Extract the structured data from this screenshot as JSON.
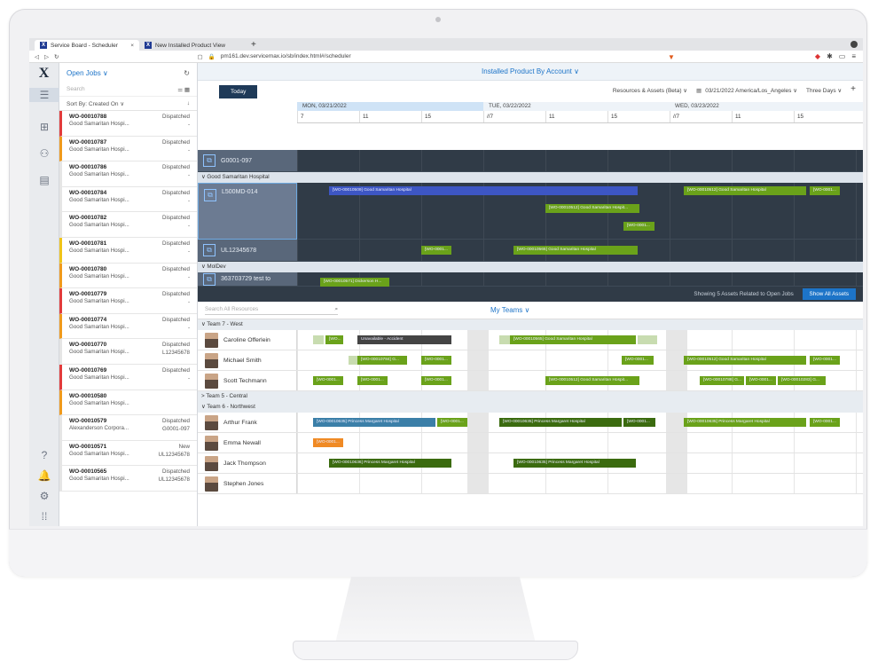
{
  "browser": {
    "tabs": [
      {
        "label": "Service Board - Scheduler",
        "close": "×"
      },
      {
        "label": "New Installed Product View",
        "close": ""
      }
    ],
    "new_tab": "+",
    "url": "pm161.dev.servicemax.io/sb/index.html#/scheduler"
  },
  "rail": {
    "logo": "X"
  },
  "jobs": {
    "title": "Open Jobs ∨",
    "search_placeholder": "Search",
    "sort_label": "Sort By: Created On ∨",
    "items": [
      {
        "wo": "WO-00010788",
        "account": "Good Samaritan Hospi...",
        "status": "Dispatched",
        "ip": "-",
        "color": "red"
      },
      {
        "wo": "WO-00010787",
        "account": "Good Samaritan Hospi...",
        "status": "Dispatched",
        "ip": "-",
        "color": "orange"
      },
      {
        "wo": "WO-00010786",
        "account": "Good Samaritan Hospi...",
        "status": "Dispatched",
        "ip": "-",
        "color": "white"
      },
      {
        "wo": "WO-00010784",
        "account": "Good Samaritan Hospi...",
        "status": "Dispatched",
        "ip": "-",
        "color": "white"
      },
      {
        "wo": "WO-00010782",
        "account": "Good Samaritan Hospi...",
        "status": "Dispatched",
        "ip": "-",
        "color": "white"
      },
      {
        "wo": "WO-00010781",
        "account": "Good Samaritan Hospi...",
        "status": "Dispatched",
        "ip": "-",
        "color": "yellow"
      },
      {
        "wo": "WO-00010780",
        "account": "Good Samaritan Hospi...",
        "status": "Dispatched",
        "ip": "-",
        "color": "orange"
      },
      {
        "wo": "WO-00010779",
        "account": "Good Samaritan Hospi...",
        "status": "Dispatched",
        "ip": "-",
        "color": "red"
      },
      {
        "wo": "WO-00010774",
        "account": "Good Samaritan Hospi...",
        "status": "Dispatched",
        "ip": "-",
        "color": "orange"
      },
      {
        "wo": "WO-00010770",
        "account": "Good Samaritan Hospi...",
        "status": "Dispatched",
        "ip": "L12345678",
        "color": "white"
      },
      {
        "wo": "WO-00010769",
        "account": "Good Samaritan Hospi...",
        "status": "Dispatched",
        "ip": "-",
        "color": "red"
      },
      {
        "wo": "WO-00010580",
        "account": "Good Samaritan Hospi...",
        "status": "",
        "ip": "",
        "color": "orange"
      },
      {
        "wo": "WO-00010579",
        "account": "Alexanderson Corpora...",
        "status": "Dispatched",
        "ip": "G0001-097",
        "color": "white"
      },
      {
        "wo": "WO-00010571",
        "account": "Good Samaritan Hospi...",
        "status": "New",
        "ip": "UL12345678",
        "color": "white"
      },
      {
        "wo": "WO-00010565",
        "account": "Good Samaritan Hospi...",
        "status": "Dispatched",
        "ip": "UL12345678",
        "color": "white"
      }
    ]
  },
  "header": {
    "title": "Installed Product By Account ∨"
  },
  "toolbar": {
    "today": "Today",
    "resources": "Resources & Assets (Beta) ∨",
    "date": "03/21/2022 America/Los_Angeles ∨",
    "range": "Three Days ∨",
    "add": "+"
  },
  "days": [
    "MON, 03/21/2022",
    "TUE, 03/22/2022",
    "WED, 03/23/2022"
  ],
  "hours": [
    "7",
    "11",
    "15",
    "//7",
    "11",
    "15",
    "//7",
    "11",
    "15"
  ],
  "assets": {
    "groups": [
      {
        "label": "",
        "rows": [
          {
            "name": "G0001-097",
            "bars": []
          }
        ]
      },
      {
        "label": "∨ Good Samaritan Hospital",
        "rows": [
          {
            "name": "L500MD-014",
            "bars": [
              "[WO-00010509] Good Samaritan Hospital",
              "[WO-00010512] Good Samaritan Hospital",
              "[WO-0001...",
              "[WO-00010512] Good Samaritan Hospit...",
              "[WO-0001..."
            ]
          },
          {
            "name": "UL12345678",
            "bars": [
              "[WO-0001...",
              "[WO-00010565] Good Samaritan Hospital"
            ]
          }
        ]
      },
      {
        "label": "∨ MolDev",
        "rows": [
          {
            "name": "363703729 test to",
            "bars": [
              "[WO-00010571] Dickerson H..."
            ]
          }
        ]
      }
    ],
    "showing": "Showing 5 Assets Related to Open Jobs",
    "show_all": "Show All Assets"
  },
  "teams": {
    "search_placeholder": "Search All Resources",
    "title": "My Teams ∨",
    "groups": [
      {
        "label": "∨ Team 7 - West",
        "techs": [
          {
            "name": "Caroline Offerlein",
            "bars": [
              "[WO...",
              "Unavailable - Accident",
              "[WO-00010565] Good Samaritan Hospital"
            ]
          },
          {
            "name": "Michael Smith",
            "bars": [
              "[WO-00010784] G...",
              "[WO-0001...",
              "[WO-0001...",
              "[WO-00010512] Good Samaritan Hospital",
              "[WO-0001..."
            ]
          },
          {
            "name": "Scott Techmann",
            "bars": [
              "[WO-0001...",
              "[WO-0001...",
              "[WO-0001...",
              "[WO-00010512] Good Samaritan Hospit...",
              "[WO-00010788] G...",
              "[WO-0001...",
              "[WO-00010283] G..."
            ]
          }
        ]
      },
      {
        "label": "> Team 5 - Central",
        "techs": []
      },
      {
        "label": "∨ Team 6 - Northwest",
        "techs": [
          {
            "name": "Arthur Frank",
            "bars": [
              "[WO-00010635] Princess Margaret Hospital",
              "[WO-0001...",
              "[WO-00010635] Princess Margaret Hospital",
              "[WO-0001...",
              "[WO-00010635] Princess Margaret Hospital",
              "[WO-0001..."
            ]
          },
          {
            "name": "Emma Newall",
            "bars": [
              "[WO-0001..."
            ]
          },
          {
            "name": "Jack Thompson",
            "bars": [
              "[WO-00010636] Princess Margaret Hospital",
              "[WO-00010635] Princess Margaret Hospital"
            ]
          },
          {
            "name": "Stephen Jones",
            "bars": []
          }
        ]
      }
    ]
  }
}
